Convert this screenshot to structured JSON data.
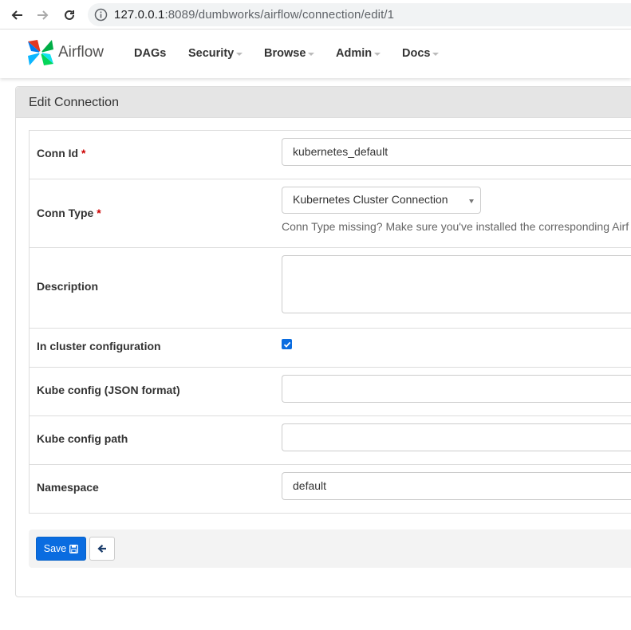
{
  "browser": {
    "url_host": "127.0.0.1",
    "url_rest": ":8089/dumbworks/airflow/connection/edit/1"
  },
  "navbar": {
    "brand": "Airflow",
    "items": [
      {
        "label": "DAGs",
        "has_caret": false
      },
      {
        "label": "Security",
        "has_caret": true
      },
      {
        "label": "Browse",
        "has_caret": true
      },
      {
        "label": "Admin",
        "has_caret": true
      },
      {
        "label": "Docs",
        "has_caret": true
      }
    ]
  },
  "panel": {
    "title": "Edit Connection"
  },
  "form": {
    "conn_id": {
      "label": "Conn Id",
      "required": "*",
      "value": "kubernetes_default"
    },
    "conn_type": {
      "label": "Conn Type",
      "required": "*",
      "value": "Kubernetes Cluster Connection",
      "help": "Conn Type missing? Make sure you've installed the corresponding Airf"
    },
    "description": {
      "label": "Description",
      "value": ""
    },
    "in_cluster": {
      "label": "In cluster configuration",
      "checked": true
    },
    "kube_config": {
      "label": "Kube config (JSON format)",
      "value": ""
    },
    "kube_config_path": {
      "label": "Kube config path",
      "value": ""
    },
    "namespace": {
      "label": "Namespace",
      "value": "default"
    }
  },
  "actions": {
    "save_label": "Save",
    "save_icon": "floppy-disk-icon",
    "back_icon": "arrow-left-icon"
  },
  "colors": {
    "primary": "#0a6ce0",
    "required": "#cc0000",
    "panel_heading": "#e5e5e5"
  }
}
